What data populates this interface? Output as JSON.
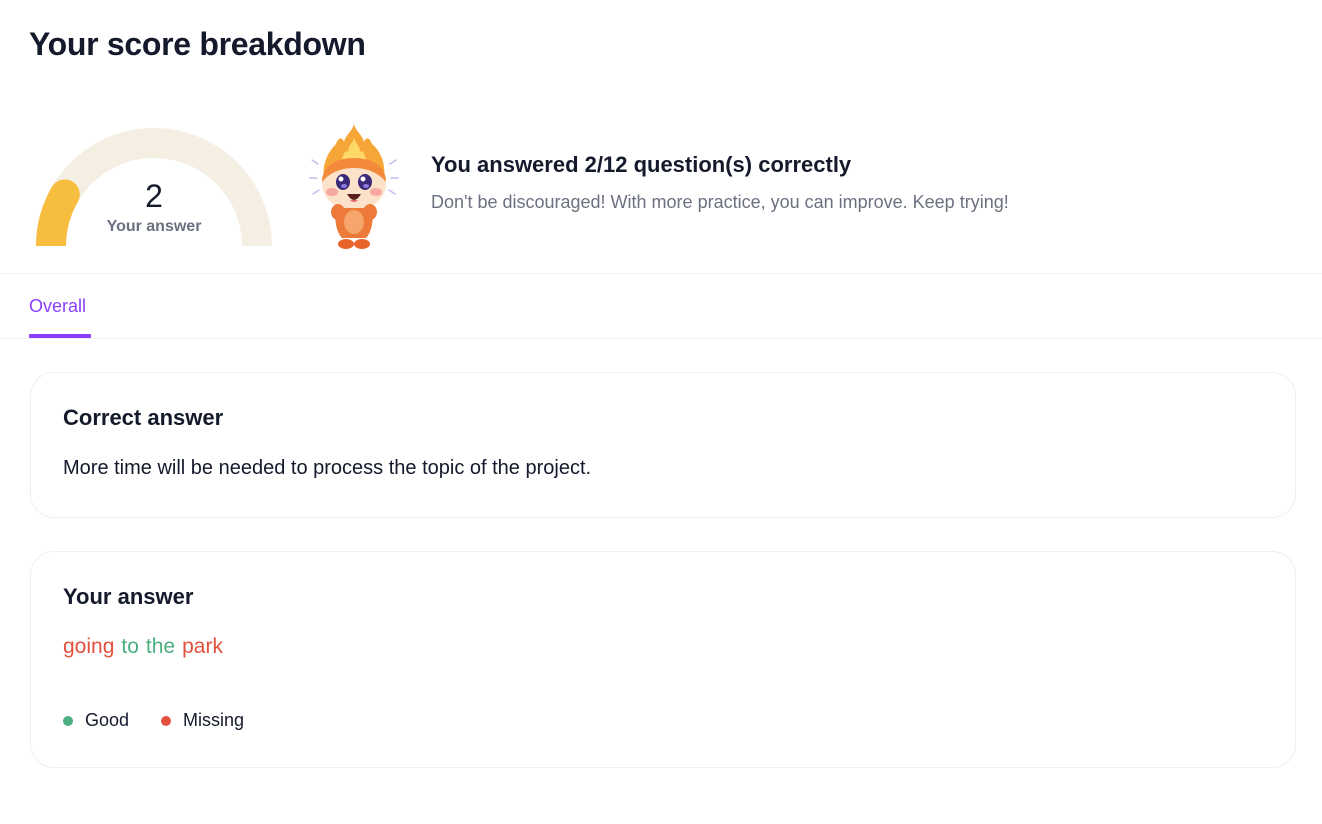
{
  "page": {
    "title": "Your score breakdown"
  },
  "score": {
    "value": "2",
    "label": "Your answer",
    "correct": 2,
    "total": 12,
    "track_color": "#f5efe3",
    "fill_color": "#f6bd3f"
  },
  "summary": {
    "title": "You answered 2/12 question(s) correctly",
    "message": "Don't be discouraged! With more practice, you can improve. Keep trying!"
  },
  "tabs": [
    {
      "label": "Overall",
      "active": true
    }
  ],
  "correct_answer": {
    "title": "Correct answer",
    "text": "More time will be needed to process the topic of the project."
  },
  "your_answer": {
    "title": "Your answer",
    "words": [
      {
        "text": "going",
        "status": "missing"
      },
      {
        "text": "to",
        "status": "good"
      },
      {
        "text": "the",
        "status": "good"
      },
      {
        "text": "park",
        "status": "missing"
      }
    ]
  },
  "legend": [
    {
      "label": "Good",
      "status": "good"
    },
    {
      "label": "Missing",
      "status": "missing"
    }
  ],
  "colors": {
    "good": "#4caf82",
    "missing": "#e2513d",
    "accent": "#8a3ffc",
    "text_muted": "#6b7180"
  }
}
